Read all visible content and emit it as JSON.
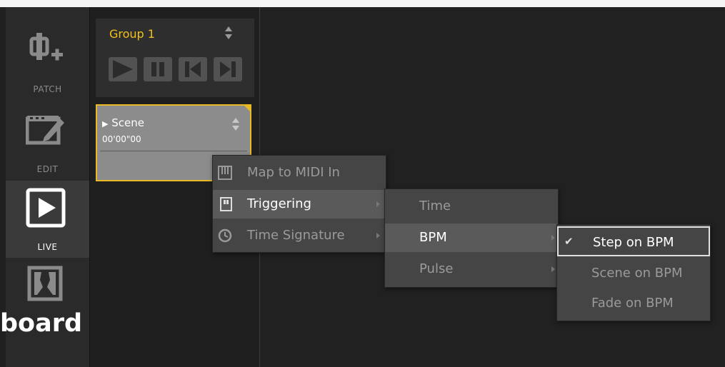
{
  "sidebar": {
    "items": [
      {
        "label": "PATCH",
        "icon": "patch-icon"
      },
      {
        "label": "EDIT",
        "icon": "edit-icon"
      },
      {
        "label": "LIVE",
        "icon": "live-icon"
      },
      {
        "label": "",
        "icon": "stage-icon"
      }
    ]
  },
  "group": {
    "title": "Group 1",
    "controls": [
      "play-icon",
      "pause-icon",
      "previous-icon",
      "next-icon"
    ]
  },
  "scene": {
    "name": "Scene",
    "time": "00'00\"00"
  },
  "context_menu": {
    "items": [
      {
        "label": "Map to MIDI In",
        "icon": "piano-icon"
      },
      {
        "label": "Triggering",
        "icon": "trigger-icon"
      },
      {
        "label": "Time Signature",
        "icon": "clock-icon"
      }
    ]
  },
  "triggering_menu": {
    "items": [
      "Time",
      "BPM",
      "Pulse"
    ]
  },
  "bpm_menu": {
    "items": [
      "Step on BPM",
      "Scene on BPM",
      "Fade on BPM"
    ],
    "checked": "✔"
  },
  "overlay_text": "board",
  "colors": {
    "accent": "#f2c01e",
    "selected_border": "#e8b923",
    "menu_bg": "#454545",
    "menu_highlight": "#5a5a5a"
  }
}
